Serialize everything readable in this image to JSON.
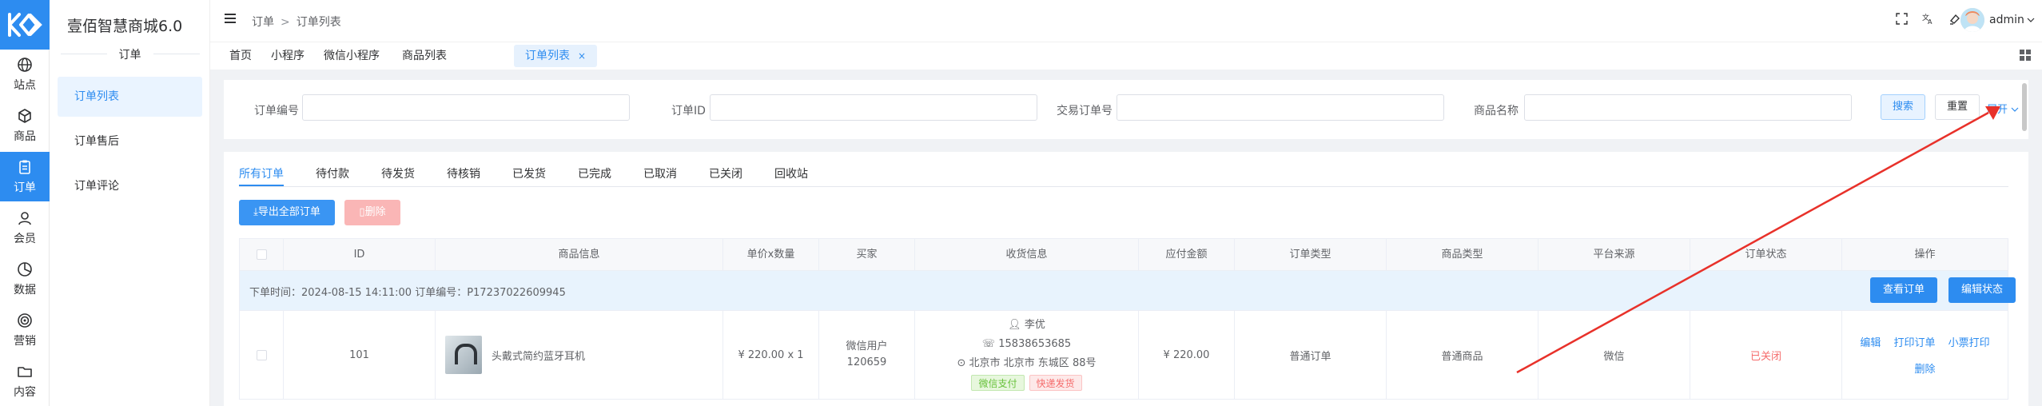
{
  "app": {
    "brand": "壹佰智慧商城6.0",
    "section_title": "订单"
  },
  "rail": [
    {
      "label": "站点",
      "icon": "globe-icon"
    },
    {
      "label": "商品",
      "icon": "box-icon"
    },
    {
      "label": "订单",
      "icon": "clipboard-icon",
      "active": true
    },
    {
      "label": "会员",
      "icon": "user-icon"
    },
    {
      "label": "数据",
      "icon": "chart-pie-icon"
    },
    {
      "label": "营销",
      "icon": "target-icon"
    },
    {
      "label": "内容",
      "icon": "folder-icon"
    }
  ],
  "subnav": [
    {
      "label": "订单列表",
      "active": true
    },
    {
      "label": "订单售后"
    },
    {
      "label": "订单评论"
    }
  ],
  "header": {
    "breadcrumb": [
      "订单",
      "订单列表"
    ],
    "breadcrumb_sep": ">",
    "username": "admin"
  },
  "tags": [
    {
      "label": "首页"
    },
    {
      "label": "小程序"
    },
    {
      "label": "微信小程序"
    },
    {
      "label": "商品列表"
    },
    {
      "label": "订单列表",
      "active": true,
      "close": "×"
    }
  ],
  "search": {
    "fields": [
      {
        "label": "订单编号",
        "value": ""
      },
      {
        "label": "订单ID",
        "value": ""
      },
      {
        "label": "交易订单号",
        "value": ""
      },
      {
        "label": "商品名称",
        "value": ""
      }
    ],
    "search_label": "搜索",
    "reset_label": "重置",
    "expand_label": "展开"
  },
  "order_tabs": [
    "所有订单",
    "待付款",
    "待发货",
    "待核销",
    "已发货",
    "已完成",
    "已取消",
    "已关闭",
    "回收站"
  ],
  "actions": {
    "export_label": "导出全部订单",
    "delete_label": "删除"
  },
  "table": {
    "columns": [
      "ID",
      "商品信息",
      "单价x数量",
      "买家",
      "收货信息",
      "应付金额",
      "订单类型",
      "商品类型",
      "平台来源",
      "订单状态",
      "操作"
    ],
    "group": {
      "text": "下单时间：2024-08-15 14:11:00   订单编号：P17237022609945",
      "view_label": "查看订单",
      "edit_label": "编辑状态"
    },
    "row": {
      "id": "101",
      "product_name": "头戴式简约蓝牙耳机",
      "price_qty": "¥ 220.00 x 1",
      "buyer_line1": "微信用户",
      "buyer_line2": "120659",
      "receiver_name": "李优",
      "receiver_phone": "15838653685",
      "receiver_address": "北京市 北京市 东城区 88号",
      "pay_badge": "微信支付",
      "ship_badge": "快递发货",
      "amount": "¥  220.00",
      "order_type": "普通订单",
      "product_type": "普通商品",
      "platform": "微信",
      "status": "已关闭",
      "ops": [
        "编辑",
        "打印订单",
        "小票打印",
        "删除"
      ]
    }
  },
  "colors": {
    "primary": "#2d8cf0",
    "danger": "#f56c6c",
    "annotation_arrow": "#e8312a"
  }
}
